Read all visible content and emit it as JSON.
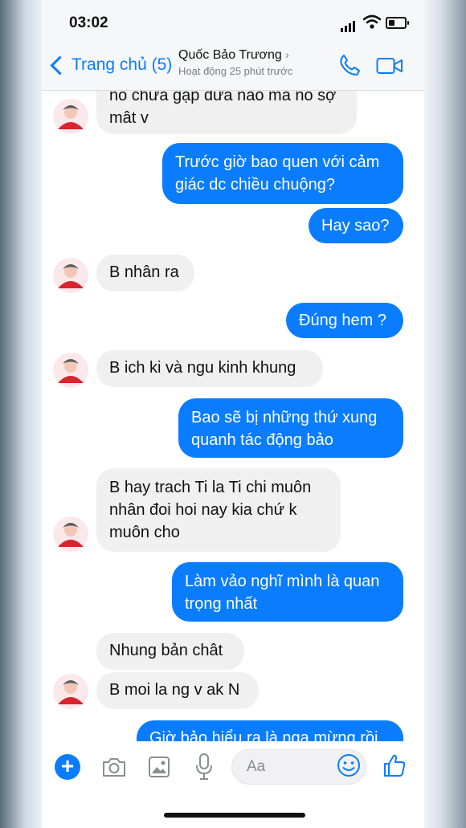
{
  "status_bar": {
    "time": "03:02"
  },
  "header": {
    "back_label": "Trang chủ (5)",
    "contact_name": "Quốc Bảo Trương",
    "contact_status": "Hoạt động 25 phút trước"
  },
  "messages": [
    {
      "side": "in",
      "lines": [
        "no chưa gạp dưa nào ma no sợ",
        "mât v"
      ]
    },
    {
      "side": "out",
      "lines": [
        "Trước giờ bao quen với cảm",
        "giác dc chiều chuộng?"
      ]
    },
    {
      "side": "out",
      "lines": [
        "Hay sao?"
      ]
    },
    {
      "side": "in",
      "lines": [
        "B nhân ra"
      ]
    },
    {
      "side": "out",
      "lines": [
        "Đúng hem ?"
      ]
    },
    {
      "side": "in",
      "lines": [
        "B ich ki và ngu kinh khung"
      ]
    },
    {
      "side": "out",
      "lines": [
        "Bao sẽ bị những thứ xung",
        "quanh tác động bảo"
      ]
    },
    {
      "side": "in",
      "lines": [
        "B hay trach Ti la Ti chi muôn",
        "nhân đoi hoi nay kia chứ k",
        "muôn cho"
      ]
    },
    {
      "side": "out",
      "lines": [
        "Làm vảo nghĩ mình là quan",
        "trọng nhất"
      ]
    },
    {
      "side": "in",
      "lines": [
        "Nhung bản chât"
      ]
    },
    {
      "side": "in",
      "lines": [
        "B moi la ng v ak N"
      ]
    },
    {
      "side": "out",
      "lines": [
        "Giờ bảo hiểu ra là nga mừng rồi"
      ]
    }
  ],
  "composer": {
    "placeholder": "Aa"
  },
  "colors": {
    "accent": "#0a7cff",
    "incoming_bubble": "#f1f0f0",
    "header_bg": "#f6f7f9"
  }
}
